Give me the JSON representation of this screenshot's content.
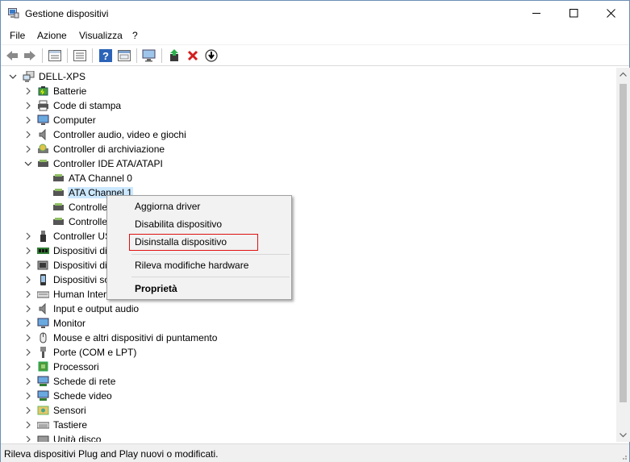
{
  "window": {
    "title": "Gestione dispositivi",
    "controls": {
      "minimize": "minimize-icon",
      "maximize": "maximize-icon",
      "close": "close-icon"
    }
  },
  "menubar": {
    "items": [
      "File",
      "Azione",
      "Visualizza",
      "?"
    ]
  },
  "toolbar": {
    "buttons": [
      "back-arrow-icon",
      "forward-arrow-icon",
      "properties-view-icon",
      "list-view-icon",
      "help-icon",
      "details-panel-icon",
      "monitor-scan-icon",
      "update-driver-icon",
      "uninstall-icon",
      "download-icon"
    ]
  },
  "tree": {
    "root": "DELL-XPS",
    "items": [
      {
        "label": "Batterie",
        "icon": "battery-icon"
      },
      {
        "label": "Code di stampa",
        "icon": "printer-icon"
      },
      {
        "label": "Computer",
        "icon": "computer-icon"
      },
      {
        "label": "Controller audio, video e giochi",
        "icon": "speaker-icon"
      },
      {
        "label": "Controller di archiviazione",
        "icon": "storage-controller-icon"
      },
      {
        "label": "Controller IDE ATA/ATAPI",
        "icon": "ide-controller-icon",
        "expanded": true,
        "children": [
          {
            "label": "ATA Channel 0"
          },
          {
            "label": "ATA Channel 1",
            "selected": true
          },
          {
            "label": "Controlle"
          },
          {
            "label": "Controlle"
          }
        ]
      },
      {
        "label": "Controller US",
        "icon": "usb-icon"
      },
      {
        "label": "Dispositivi di",
        "icon": "memory-icon"
      },
      {
        "label": "Dispositivi di",
        "icon": "hid-icon"
      },
      {
        "label": "Dispositivi so",
        "icon": "phone-icon"
      },
      {
        "label": "Human Inter",
        "icon": "keyboard-human-icon"
      },
      {
        "label": "Input e output audio",
        "icon": "speaker-icon"
      },
      {
        "label": "Monitor",
        "icon": "monitor-icon"
      },
      {
        "label": "Mouse e altri dispositivi di puntamento",
        "icon": "mouse-icon"
      },
      {
        "label": "Porte (COM e LPT)",
        "icon": "port-icon"
      },
      {
        "label": "Processori",
        "icon": "processor-icon"
      },
      {
        "label": "Schede di rete",
        "icon": "network-icon"
      },
      {
        "label": "Schede video",
        "icon": "display-adapter-icon"
      },
      {
        "label": "Sensori",
        "icon": "sensor-icon"
      },
      {
        "label": "Tastiere",
        "icon": "keyboard-icon"
      },
      {
        "label": "Unità disco",
        "icon": "disk-icon"
      }
    ]
  },
  "context_menu": {
    "items": [
      "Aggiorna driver",
      "Disabilita dispositivo",
      "Disinstalla dispositivo",
      "Rileva modifiche hardware",
      "Proprietà"
    ],
    "highlighted_item": "Disinstalla dispositivo",
    "highlight_color": "#e01010"
  },
  "statusbar": {
    "text": "Rileva dispositivi Plug and Play nuovi o modificati."
  },
  "colors": {
    "selection": "#cce8ff",
    "window_border": "#6c8fb4"
  }
}
